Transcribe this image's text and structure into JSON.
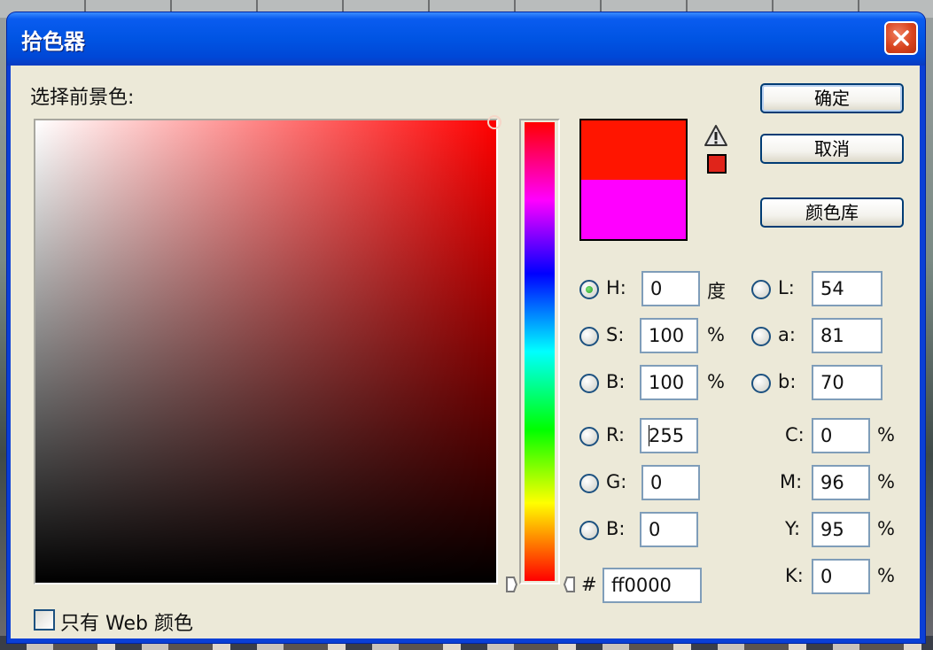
{
  "window": {
    "title": "拾色器",
    "close_icon": "close-x-icon"
  },
  "picker": {
    "prompt": "选择前景色:",
    "current_hue_deg": 0,
    "field_cursor": {
      "saturation_pct": 100,
      "brightness_pct": 100
    },
    "new_color": "#ff1500",
    "old_color": "#ff00ff",
    "gamut_warning_icon": "warning-triangle-icon",
    "gamut_color": "#e0241a"
  },
  "buttons": {
    "ok": "确定",
    "cancel": "取消",
    "libraries": "颜色库"
  },
  "hsb": [
    {
      "key": "H",
      "label": "H:",
      "value": "0",
      "unit": "度",
      "checked": true
    },
    {
      "key": "S",
      "label": "S:",
      "value": "100",
      "unit": "%",
      "checked": false
    },
    {
      "key": "B",
      "label": "B:",
      "value": "100",
      "unit": "%",
      "checked": false
    }
  ],
  "lab": [
    {
      "key": "L",
      "label": "L:",
      "value": "54",
      "checked": false
    },
    {
      "key": "a",
      "label": "a:",
      "value": "81",
      "checked": false
    },
    {
      "key": "b",
      "label": "b:",
      "value": "70",
      "checked": false
    }
  ],
  "rgb": [
    {
      "key": "R",
      "label": "R:",
      "value": "255",
      "checked": false
    },
    {
      "key": "G",
      "label": "G:",
      "value": "0",
      "checked": false
    },
    {
      "key": "B",
      "label": "B:",
      "value": "0",
      "checked": false
    }
  ],
  "cmyk": [
    {
      "key": "C",
      "label": "C:",
      "value": "0",
      "unit": "%"
    },
    {
      "key": "M",
      "label": "M:",
      "value": "96",
      "unit": "%"
    },
    {
      "key": "Y",
      "label": "Y:",
      "value": "95",
      "unit": "%"
    },
    {
      "key": "K",
      "label": "K:",
      "value": "0",
      "unit": "%"
    }
  ],
  "hex": {
    "prefix": "#",
    "value": "ff0000"
  },
  "web_only": {
    "label": "只有 Web 颜色",
    "checked": false
  }
}
